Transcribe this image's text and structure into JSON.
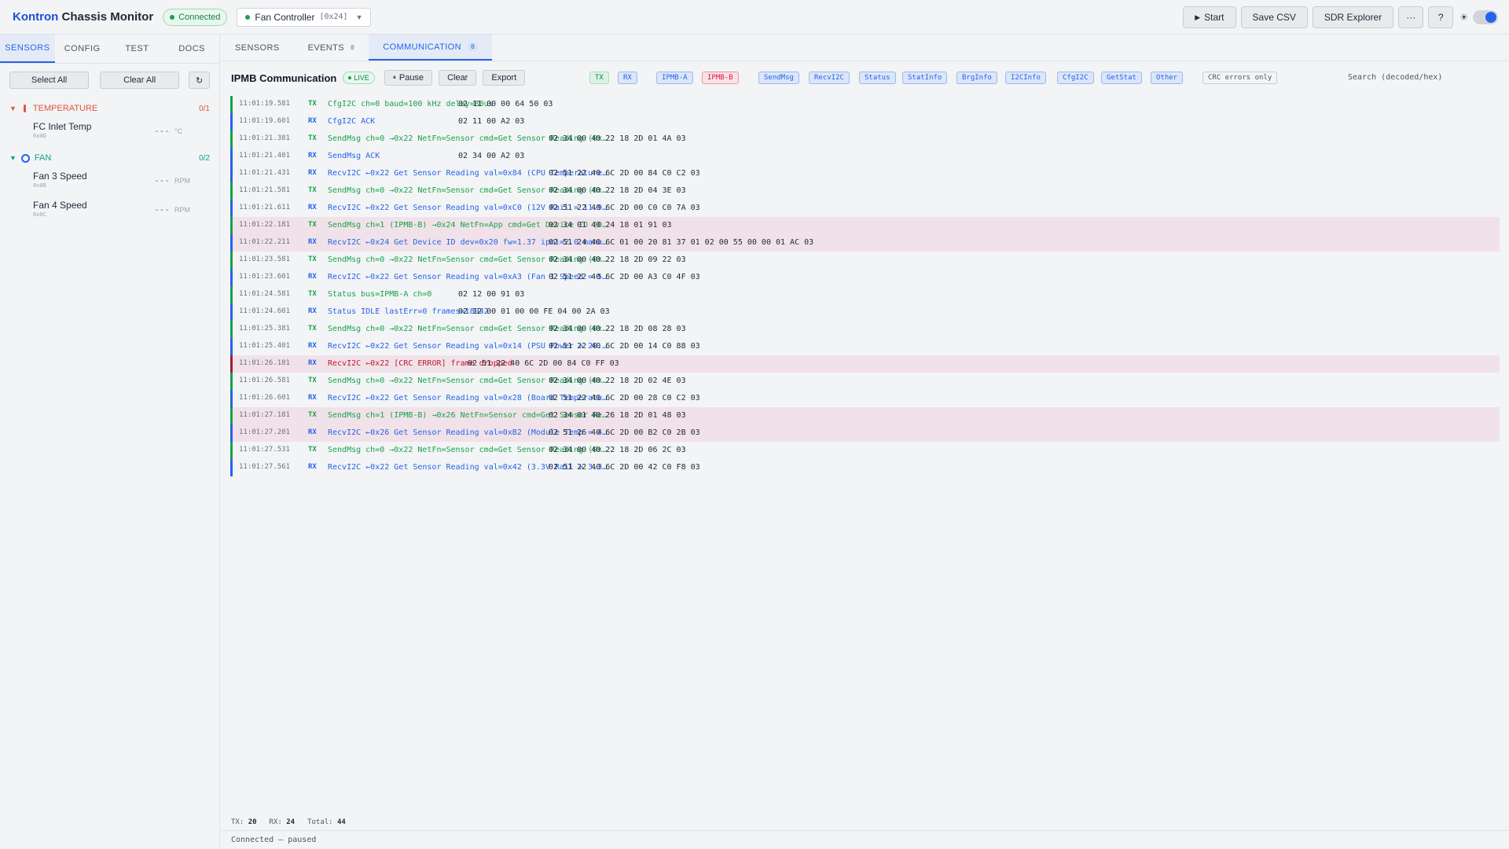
{
  "app": {
    "brand_a": "Kontron",
    "brand_b": "Chassis Monitor",
    "connection": "Connected"
  },
  "device": {
    "name": "Fan Controller",
    "addr": "[0x24]",
    "caret": "▼"
  },
  "toolbar": {
    "start": "Start",
    "start_icon": "▶",
    "save_csv": "Save CSV",
    "sdr": "SDR Explorer",
    "more": "···",
    "help": "?",
    "theme_icon": "☀"
  },
  "sidebar": {
    "tabs": [
      "SENSORS",
      "CONFIG",
      "TEST",
      "DOCS"
    ],
    "select_all": "Select All",
    "clear_all": "Clear All",
    "refresh_icon": "↻",
    "groups": [
      {
        "label": "TEMPERATURE",
        "count": "0/1",
        "tri": "▼",
        "icon": "🌡",
        "sensors": [
          {
            "name": "FC Inlet Temp",
            "addr": "0x0D",
            "value": "---",
            "unit": "°C"
          }
        ]
      },
      {
        "label": "FAN",
        "count": "0/2",
        "tri": "▼",
        "sensors": [
          {
            "name": "Fan 3 Speed",
            "addr": "0x0B",
            "value": "---",
            "unit": "RPM"
          },
          {
            "name": "Fan 4 Speed",
            "addr": "0x0C",
            "value": "---",
            "unit": "RPM"
          }
        ]
      }
    ]
  },
  "main": {
    "tabs": [
      {
        "label": "SENSORS",
        "badge": ""
      },
      {
        "label": "EVENTS",
        "badge": "0"
      },
      {
        "label": "COMMUNICATION",
        "badge": "0"
      }
    ],
    "title": "IPMB Communication",
    "live": "LIVE",
    "pause": "Pause",
    "pause_icon": "⏸",
    "clear": "Clear",
    "export": "Export",
    "filters": [
      "TX",
      "RX",
      "IPMB-A",
      "IPMB-B",
      "SendMsg",
      "RecvI2C",
      "Status",
      "StatInfo",
      "BrgInfo",
      "I2CInfo",
      "CfgI2C",
      "GetStat",
      "Other"
    ],
    "crc_only": "CRC errors only",
    "search_placeholder": "Search (decoded/hex)",
    "log": [
      {
        "ts": "11:01:19.581",
        "dir": "TX",
        "dec": "CfgI2C ch=0 baud=100 kHz delay=80us",
        "hex": "02 11 00 00 64 50 03"
      },
      {
        "ts": "11:01:19.601",
        "dir": "RX",
        "dec": "CfgI2C ACK",
        "hex": "02 11 00 A2 03"
      },
      {
        "ts": "11:01:21.381",
        "dir": "TX",
        "dec": "SendMsg ch=0 →0x22 NetFn=Sensor cmd=Get Sensor Reading (0x…",
        "hex": "02 34 00 40 22 18 2D 01 4A 03"
      },
      {
        "ts": "11:01:21.401",
        "dir": "RX",
        "dec": "SendMsg ACK",
        "hex": "02 34 00 A2 03"
      },
      {
        "ts": "11:01:21.431",
        "dir": "RX",
        "dec": "RecvI2C ←0x22 Get Sensor Reading val=0x84 (CPU Temperature…",
        "hex": "02 51 22 40 6C 2D 00 84 C0 C2 03"
      },
      {
        "ts": "11:01:21.581",
        "dir": "TX",
        "dec": "SendMsg ch=0 →0x22 NetFn=Sensor cmd=Get Sensor Reading (0x…",
        "hex": "02 34 00 40 22 18 2D 04 3E 03"
      },
      {
        "ts": "11:01:21.611",
        "dir": "RX",
        "dec": "RecvI2C ←0x22 Get Sensor Reading val=0xC0 (12V Rail = 11.9…",
        "hex": "02 51 22 40 6C 2D 00 C0 C0 7A 03"
      },
      {
        "ts": "11:01:22.181",
        "dir": "TX",
        "dec": "SendMsg ch=1 (IPMB-B) →0x24 NetFn=App cmd=Get Device ID (0…",
        "hex": "02 34 01 40 24 18 01 91 03",
        "b": true
      },
      {
        "ts": "11:01:22.211",
        "dir": "RX",
        "dec": "RecvI2C ←0x24 Get Device ID dev=0x20 fw=1.37 ipmi=2.0 manu…",
        "hex": "02 51 24 40 6C 01 00 20 81 37 01 02 00 55 00 00 01 AC 03",
        "b": true
      },
      {
        "ts": "11:01:23.581",
        "dir": "TX",
        "dec": "SendMsg ch=0 →0x22 NetFn=Sensor cmd=Get Sensor Reading (0x…",
        "hex": "02 34 00 40 22 18 2D 09 22 03"
      },
      {
        "ts": "11:01:23.601",
        "dir": "RX",
        "dec": "RecvI2C ←0x22 Get Sensor Reading val=0xA3 (Fan 1 Speed = 5…",
        "hex": "02 51 22 40 6C 2D 00 A3 C0 4F 03"
      },
      {
        "ts": "11:01:24.581",
        "dir": "TX",
        "dec": "Status bus=IPMB-A ch=0",
        "hex": "02 12 00 91 03"
      },
      {
        "ts": "11:01:24.601",
        "dir": "RX",
        "dec": "Status IDLE lastErr=0 frames=18942",
        "hex": "02 12 00 01 00 00 FE 04 00 2A 03"
      },
      {
        "ts": "11:01:25.381",
        "dir": "TX",
        "dec": "SendMsg ch=0 →0x22 NetFn=Sensor cmd=Get Sensor Reading (0x…",
        "hex": "02 34 00 40 22 18 2D 08 28 03"
      },
      {
        "ts": "11:01:25.401",
        "dir": "RX",
        "dec": "RecvI2C ←0x22 Get Sensor Reading val=0x14 (PSU Power = 20.…",
        "hex": "02 51 22 40 6C 2D 00 14 C0 88 03"
      },
      {
        "ts": "11:01:26.181",
        "dir": "RX",
        "dec": "RecvI2C ←0x22 [CRC ERROR] frame dropped",
        "hex": "02 51 22 40 6C 2D 00 84 C0 FF 03",
        "crc": true
      },
      {
        "ts": "11:01:26.581",
        "dir": "TX",
        "dec": "SendMsg ch=0 →0x22 NetFn=Sensor cmd=Get Sensor Reading (0x…",
        "hex": "02 34 00 40 22 18 2D 02 4E 03"
      },
      {
        "ts": "11:01:26.601",
        "dir": "RX",
        "dec": "RecvI2C ←0x22 Get Sensor Reading val=0x28 (Board Temperatu…",
        "hex": "02 51 22 40 6C 2D 00 28 C0 C2 03"
      },
      {
        "ts": "11:01:27.181",
        "dir": "TX",
        "dec": "SendMsg ch=1 (IPMB-B) →0x26 NetFn=Sensor cmd=Get Sensor Re…",
        "hex": "02 34 01 40 26 18 2D 01 48 03",
        "b": true
      },
      {
        "ts": "11:01:27.201",
        "dir": "RX",
        "dec": "RecvI2C ←0x26 Get Sensor Reading val=0xB2 (Module Temp = 4…",
        "hex": "02 51 26 40 6C 2D 00 B2 C0 2B 03",
        "b": true
      },
      {
        "ts": "11:01:27.531",
        "dir": "TX",
        "dec": "SendMsg ch=0 →0x22 NetFn=Sensor cmd=Get Sensor Reading (0x…",
        "hex": "02 34 00 40 22 18 2D 06 2C 03"
      },
      {
        "ts": "11:01:27.561",
        "dir": "RX",
        "dec": "RecvI2C ←0x22 Get Sensor Reading val=0x42 (3.3V Rail = 3.3…",
        "hex": "02 51 22 40 6C 2D 00 42 C0 F8 03"
      }
    ],
    "stats": {
      "tx_label": "TX:",
      "tx": "20",
      "rx_label": "RX:",
      "rx": "24",
      "total_label": "Total:",
      "total": "44"
    },
    "status": "Connected — paused"
  }
}
